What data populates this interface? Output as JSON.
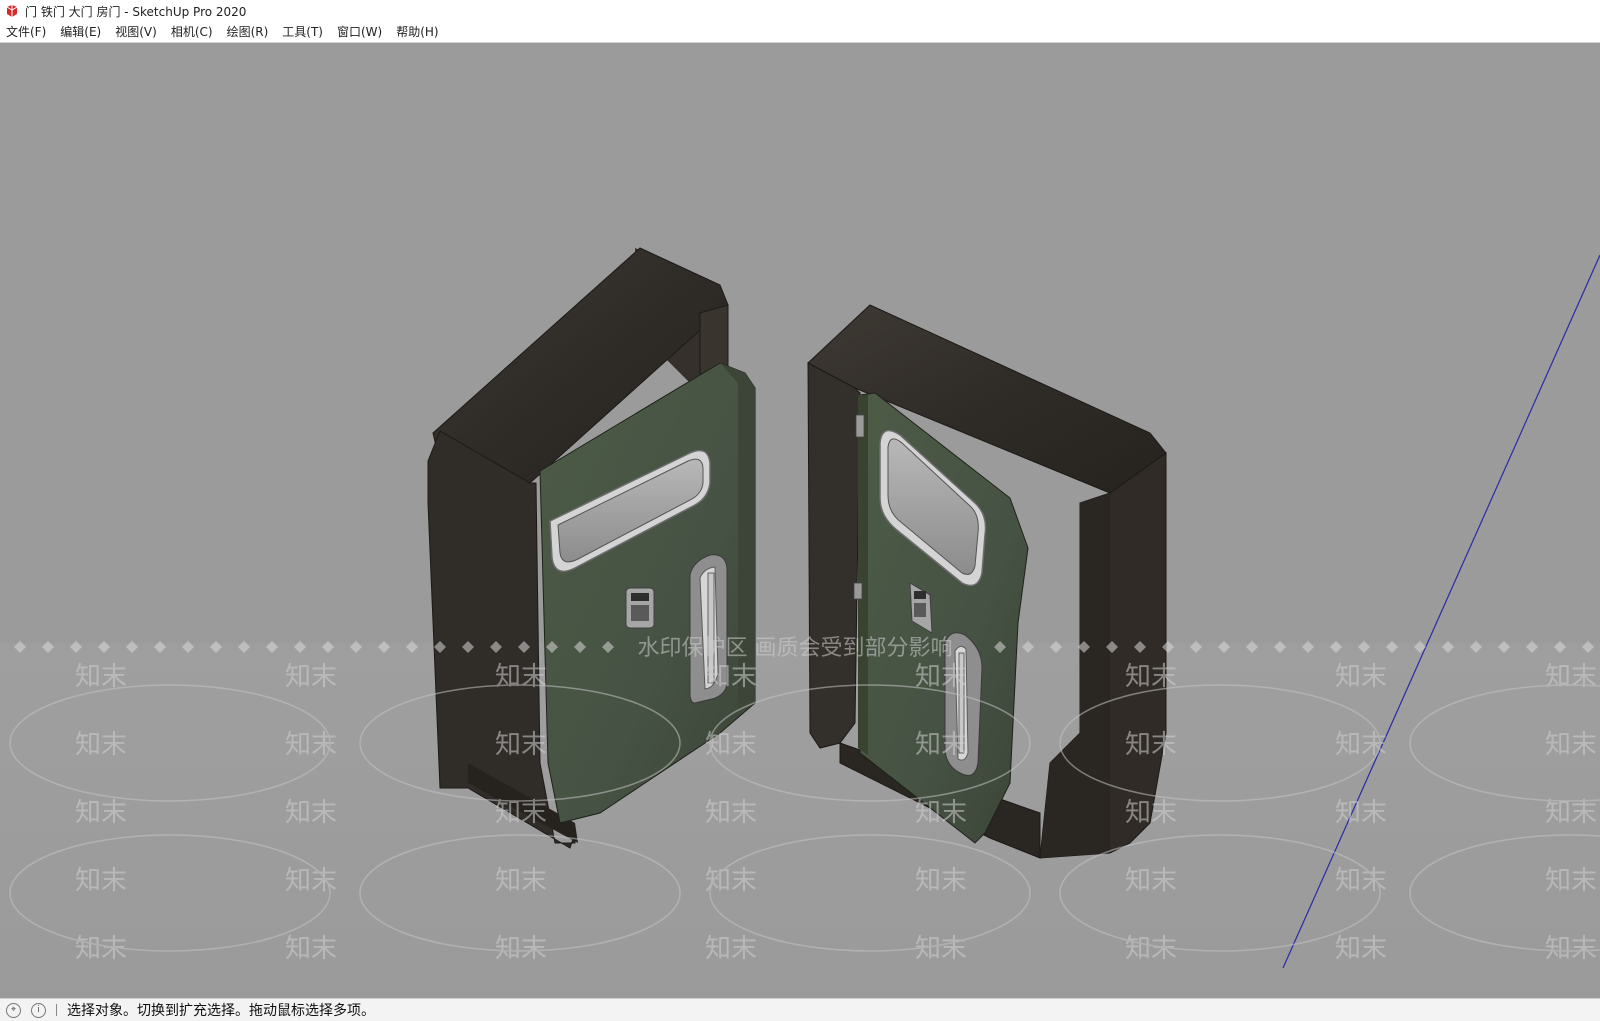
{
  "window": {
    "title": "门 铁门 大门 房门 - SketchUp Pro 2020",
    "icon": "sketchup-logo-icon"
  },
  "menubar": {
    "items": [
      {
        "label": "文件(F)"
      },
      {
        "label": "编辑(E)"
      },
      {
        "label": "视图(V)"
      },
      {
        "label": "相机(C)"
      },
      {
        "label": "绘图(R)"
      },
      {
        "label": "工具(T)"
      },
      {
        "label": "窗口(W)"
      },
      {
        "label": "帮助(H)"
      }
    ]
  },
  "viewport": {
    "background_color": "#9b9b9b",
    "model": "two-metal-doors-with-frames",
    "axis_color": "#2a2aa8",
    "watermark": {
      "banner": "水印保护区   画质会受到部分影响",
      "text": "知末"
    }
  },
  "statusbar": {
    "icons": [
      "geo-location-icon",
      "info-icon"
    ],
    "message": "选择对象。切换到扩充选择。拖动鼠标选择多项。"
  }
}
